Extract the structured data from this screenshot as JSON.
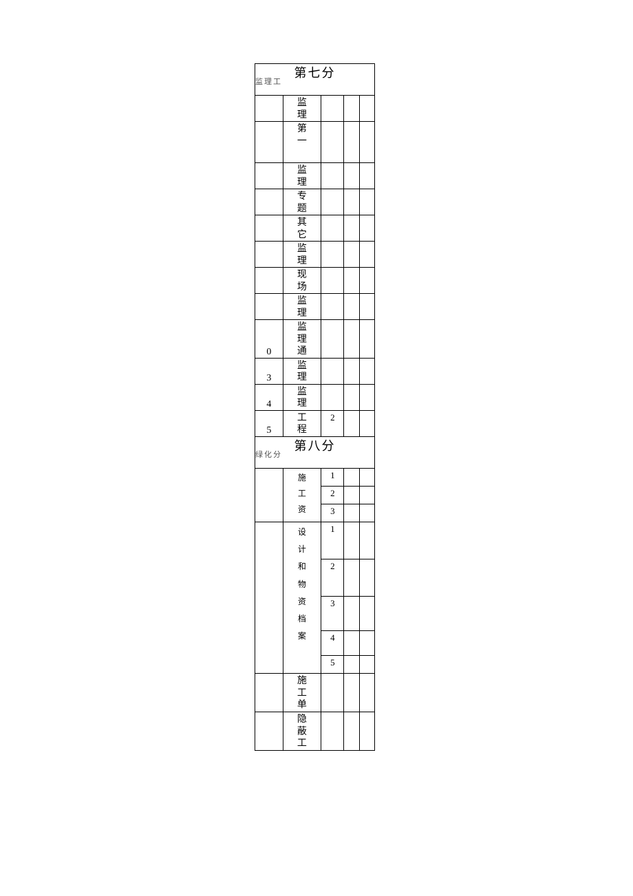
{
  "section7": {
    "title": "第七分",
    "subtitle": "监理工",
    "rows": [
      {
        "num": "",
        "text": "监理"
      },
      {
        "num": "",
        "text": "第一"
      },
      {
        "num": "",
        "text": "监理"
      },
      {
        "num": "",
        "text": "专题"
      },
      {
        "num": "",
        "text": "其它"
      },
      {
        "num": "",
        "text": "监理"
      },
      {
        "num": "",
        "text": "现场"
      },
      {
        "num": "",
        "text": "监理"
      },
      {
        "num": "0",
        "text": "监理通"
      },
      {
        "num": "3",
        "text": "监理"
      },
      {
        "num": "4",
        "text": "监理"
      },
      {
        "num": "5",
        "text": "工程",
        "sub": "2"
      }
    ]
  },
  "section8": {
    "title": "第八分",
    "subtitle": "绿化分",
    "group1": {
      "label": "施工资",
      "items": [
        "1",
        "2",
        "3"
      ]
    },
    "group2": {
      "label": "设计和物资档案",
      "items": [
        "1",
        "2",
        "3",
        "4",
        "5"
      ]
    },
    "row_shigong": "施工单",
    "row_yinbi": "隐蔽工"
  }
}
